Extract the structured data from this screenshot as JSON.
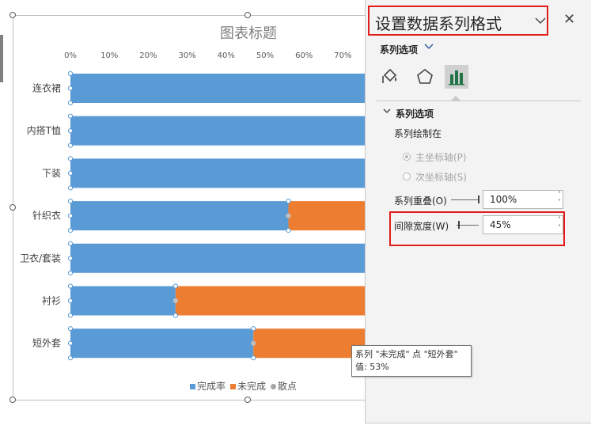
{
  "chart_title": "图表标题",
  "chart_data": {
    "type": "bar",
    "orientation": "horizontal",
    "stacked": true,
    "title": "图表标题",
    "categories": [
      "连衣裙",
      "内搭T恤",
      "下装",
      "针织衣",
      "卫衣/套装",
      "衬衫",
      "短外套"
    ],
    "series": [
      {
        "name": "完成率",
        "values": [
          100,
          100,
          100,
          56,
          100,
          27,
          47
        ],
        "color": "#5b9bd5"
      },
      {
        "name": "未完成",
        "values": [
          0,
          0,
          0,
          44,
          0,
          73,
          53
        ],
        "color": "#ed7d31"
      },
      {
        "name": "散点",
        "values": [],
        "color": "#a5a5a5"
      }
    ],
    "x_ticks": [
      "0%",
      "10%",
      "20%",
      "30%",
      "40%",
      "50%",
      "60%",
      "70%"
    ],
    "xlim": [
      0,
      100
    ],
    "axis_position": "top",
    "legend_position": "bottom"
  },
  "legend": [
    {
      "label": "完成率",
      "color": "#5b9bd5",
      "shape": "square"
    },
    {
      "label": "未完成",
      "color": "#ed7d31",
      "shape": "square"
    },
    {
      "label": "散点",
      "color": "#a5a5a5",
      "shape": "circle"
    }
  ],
  "tooltip": {
    "line1": "系列 \"未完成\" 点 \"短外套\"",
    "line2": "值: 53%"
  },
  "panel": {
    "title": "设置数据系列格式",
    "close": "✕",
    "series_options_dropdown": "系列选项",
    "section_header": "系列选项",
    "plot_on_label": "系列绘制在",
    "primary_axis": "主坐标轴(P)",
    "secondary_axis": "次坐标轴(S)",
    "overlap_label": "系列重叠(O)",
    "overlap_value": "100%",
    "gap_label": "间隙宽度(W)",
    "gap_value": "45%"
  },
  "icons": {
    "fill": "paint-bucket-icon",
    "effects": "pentagon-icon",
    "series_options": "bar-chart-icon"
  },
  "colors": {
    "highlight_box": "#e21b1b",
    "panel_bg": "#f3f3f3"
  }
}
